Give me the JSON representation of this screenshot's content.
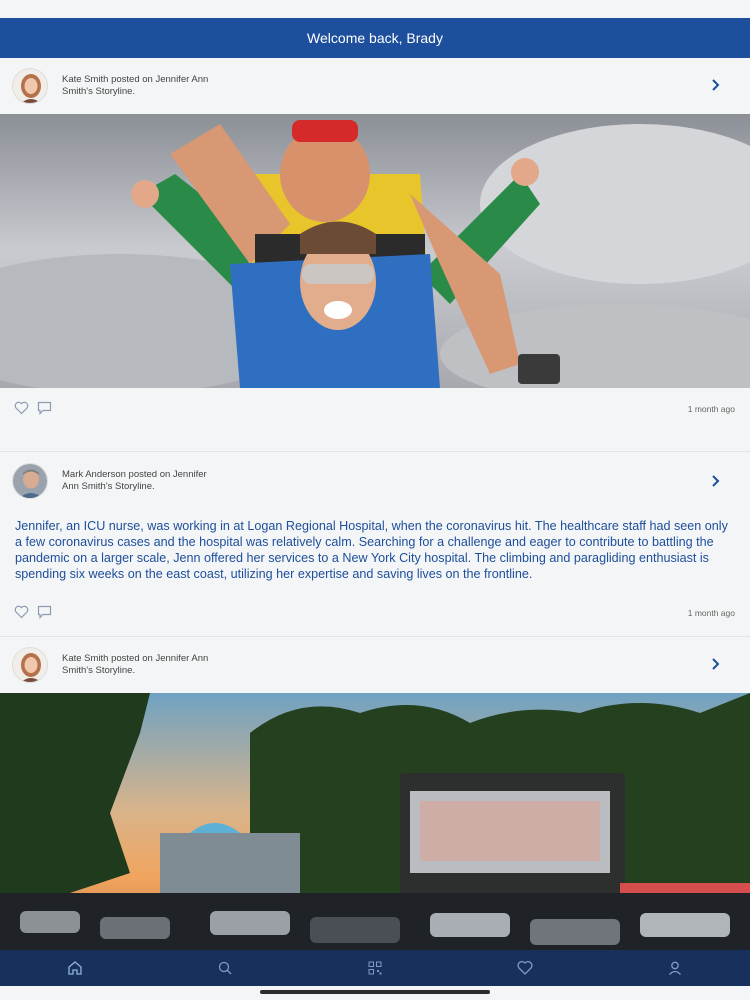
{
  "header": {
    "title": "Welcome back, Brady"
  },
  "posts": [
    {
      "author_line": "Kate Smith posted on Jennifer Ann Smith's Storyline.",
      "timestamp": "1 month ago",
      "media": "photo-skydive"
    },
    {
      "author_line": "Mark Anderson posted on Jennifer Ann Smith's Storyline.",
      "timestamp": "1 month ago",
      "body": "Jennifer, an ICU nurse, was working in at Logan Regional Hospital, when the coronavirus hit. The healthcare staff had seen only a few coronavirus cases and the hospital was relatively calm. Searching for a challenge and eager to contribute to battling the pandemic on a larger scale, Jenn offered her services to a New York City hospital. The climbing and paragliding enthusiast is spending six weeks on the east coast, utilizing her expertise and saving lives on the frontline."
    },
    {
      "author_line": "Kate Smith posted on Jennifer Ann Smith's Storyline.",
      "media": "photo-drive-in"
    }
  ],
  "tabbar": {
    "icons": [
      "home-icon",
      "search-icon",
      "qr-code-icon",
      "heart-icon",
      "profile-icon"
    ],
    "active": "home-icon",
    "colors": {
      "background": "#17305c",
      "active": "#8fb3e0",
      "inactive": "#7f9cc8"
    }
  },
  "colors": {
    "header": "#1d4f9c",
    "body_text": "#1d4f9c",
    "background": "#f4f5f6"
  }
}
